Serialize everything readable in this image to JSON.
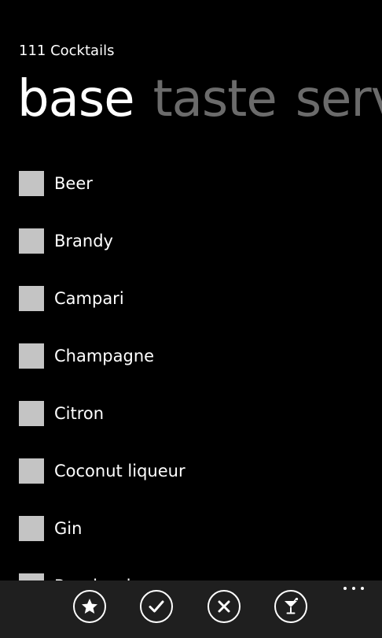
{
  "app": {
    "title": "111 Cocktails"
  },
  "pivot": {
    "tabs": [
      {
        "label": "base",
        "active": true
      },
      {
        "label": "taste",
        "active": false
      },
      {
        "label": "serv",
        "active": false
      }
    ]
  },
  "list": {
    "items": [
      {
        "label": "Beer",
        "checked": false
      },
      {
        "label": "Brandy",
        "checked": false
      },
      {
        "label": "Campari",
        "checked": false
      },
      {
        "label": "Champagne",
        "checked": false
      },
      {
        "label": "Citron",
        "checked": false
      },
      {
        "label": "Coconut liqueur",
        "checked": false
      },
      {
        "label": "Gin",
        "checked": false
      },
      {
        "label": "Peach schnapps",
        "checked": false
      }
    ]
  },
  "app_bar": {
    "buttons": [
      {
        "icon": "star-icon"
      },
      {
        "icon": "check-icon"
      },
      {
        "icon": "close-icon"
      },
      {
        "icon": "cocktail-glass-icon"
      }
    ],
    "more_icon": "ellipsis-icon"
  },
  "colors": {
    "background": "#000000",
    "text": "#ffffff",
    "inactive_tab": "#6b6b6b",
    "checkbox": "#c4c4c4",
    "app_bar": "#1f1f1f"
  }
}
